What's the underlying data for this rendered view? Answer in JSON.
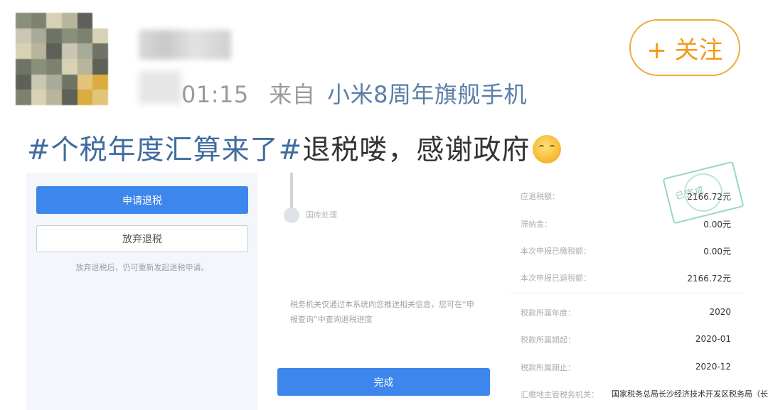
{
  "post": {
    "time": "01:15",
    "source_prefix": "来自",
    "source_device": "小米8周年旗舰手机",
    "follow_label": "+ 关注",
    "hashtag1": "#个税年度汇算来了#",
    "body_text": "退税喽，感谢政府",
    "emoji": "grinning-face-emoji"
  },
  "screen_left": {
    "apply_button": "申请退税",
    "abandon_button": "放弃退税",
    "abandon_note": "放弃退税后，仍可重新发起退税申请。"
  },
  "screen_mid": {
    "timeline_step": "国库处理",
    "notice": "税务机关仅通过本系统向您推送相关信息，您可在“申报查询”中查询退税进度",
    "done_button": "完成"
  },
  "screen_right": {
    "rows": [
      {
        "label": "应退税额：",
        "value": "2166.72元"
      },
      {
        "label": "滞纳金：",
        "value": "0.00元"
      },
      {
        "label": "本次申报已缴税额：",
        "value": "0.00元"
      },
      {
        "label": "本次申报已退税额：",
        "value": "2166.72元"
      },
      {
        "label": "税款所属年度：",
        "value": "2020"
      },
      {
        "label": "税款所属期起：",
        "value": "2020-01"
      },
      {
        "label": "税款所属期止：",
        "value": "2020-12"
      },
      {
        "label": "汇缴地主管税务机关：",
        "value": "国家税务总局长沙经济技术开发区税务局（长沙县税务"
      }
    ],
    "stamp": "已完成"
  },
  "colors": {
    "accent_blue": "#3d86ec",
    "follow_orange": "#f29a1a",
    "hashtag_blue": "#3f6c9e"
  }
}
